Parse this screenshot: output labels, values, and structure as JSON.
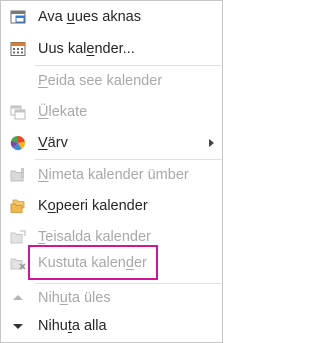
{
  "menu": {
    "items": [
      {
        "id": "open-new-window",
        "pre": "Ava ",
        "key": "u",
        "post": "ues aknas",
        "disabled": false,
        "icon": "window-icon"
      },
      {
        "id": "new-calendar",
        "pre": "Uus kal",
        "key": "e",
        "post": "nder...",
        "disabled": false,
        "icon": "calendar-icon"
      },
      {
        "id": "hide-calendar",
        "pre": "",
        "key": "P",
        "post": "eida see kalender",
        "disabled": true,
        "icon": ""
      },
      {
        "id": "overlay",
        "pre": "",
        "key": "Ü",
        "post": "lekate",
        "disabled": true,
        "icon": "overlay-icon"
      },
      {
        "id": "color",
        "pre": "",
        "key": "V",
        "post": "ärv",
        "disabled": false,
        "icon": "color-wheel-icon",
        "submenu": true
      },
      {
        "id": "rename-calendar",
        "pre": "",
        "key": "N",
        "post": "imeta kalender ümber",
        "disabled": true,
        "icon": "rename-icon"
      },
      {
        "id": "copy-calendar",
        "pre": "K",
        "key": "o",
        "post": "peeri kalender",
        "disabled": false,
        "icon": "copy-folder-icon"
      },
      {
        "id": "move-calendar",
        "pre": "",
        "key": "T",
        "post": "eisalda kalender",
        "disabled": true,
        "icon": "move-icon"
      },
      {
        "id": "delete-calendar",
        "pre": "Kustuta kalen",
        "key": "d",
        "post": "er",
        "disabled": true,
        "icon": "delete-calendar-icon"
      },
      {
        "id": "move-up",
        "pre": "Nih",
        "key": "u",
        "post": "ta üles",
        "disabled": true,
        "icon": "arrow-up-icon"
      },
      {
        "id": "move-down",
        "pre": "Nihu",
        "key": "t",
        "post": "a alla",
        "disabled": false,
        "icon": "arrow-down-icon"
      }
    ],
    "highlight_color": "#d1149a"
  }
}
